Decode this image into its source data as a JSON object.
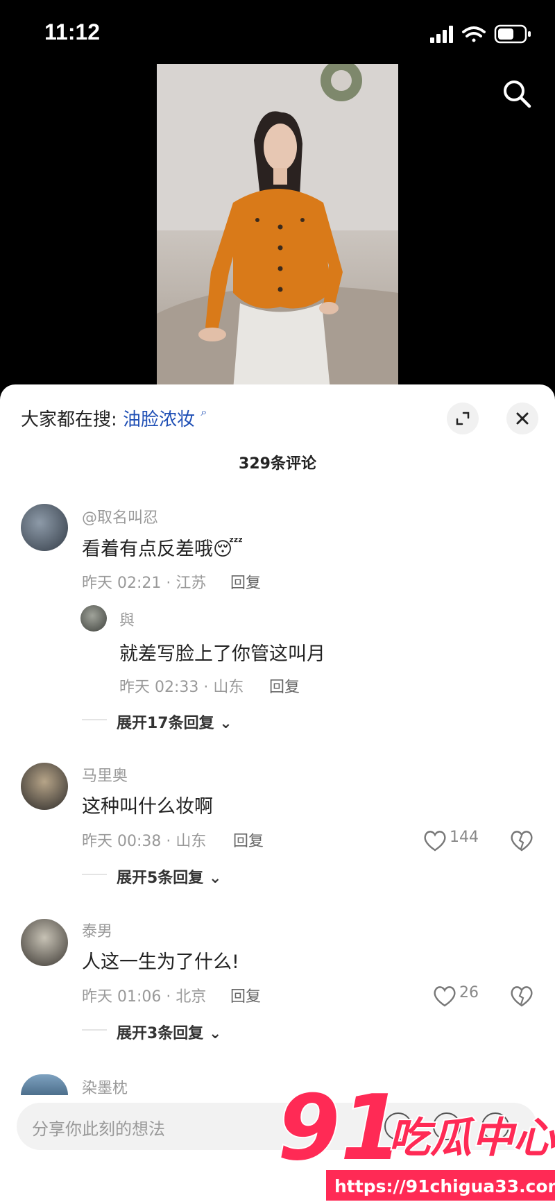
{
  "status_bar": {
    "time": "11:12"
  },
  "sheet": {
    "trending_prefix": "大家都在搜:",
    "trending_keyword": "油脸浓妆",
    "comment_count": "329条评论"
  },
  "comments": [
    {
      "username": "@取名叫忍",
      "text": "看着有点反差哦",
      "emoji": "😴",
      "meta": "昨天 02:21 · 江苏",
      "reply_label": "回复",
      "sub_reply": {
        "username": "與",
        "text": "就差写脸上了你管这叫月",
        "meta": "昨天 02:33 · 山东",
        "reply_label": "回复"
      },
      "expand": "展开17条回复"
    },
    {
      "username": "马里奥",
      "text": "这种叫什么妆啊",
      "meta": "昨天 00:38 · 山东",
      "reply_label": "回复",
      "likes": "144",
      "expand": "展开5条回复"
    },
    {
      "username": "泰男",
      "text": "人这一生为了什么!",
      "meta": "昨天 01:06 · 北京",
      "reply_label": "回复",
      "likes": "26",
      "expand": "展开3条回复"
    },
    {
      "username": "染墨枕"
    }
  ],
  "input": {
    "placeholder": "分享你此刻的想法"
  },
  "watermark": {
    "number": "91",
    "name": "吃瓜中心",
    "url": "https://91chigua33.com"
  },
  "colors": {
    "keyword": "#1f4fb5",
    "watermark": "#ff2a55",
    "sheet_bg": "#ffffff"
  }
}
